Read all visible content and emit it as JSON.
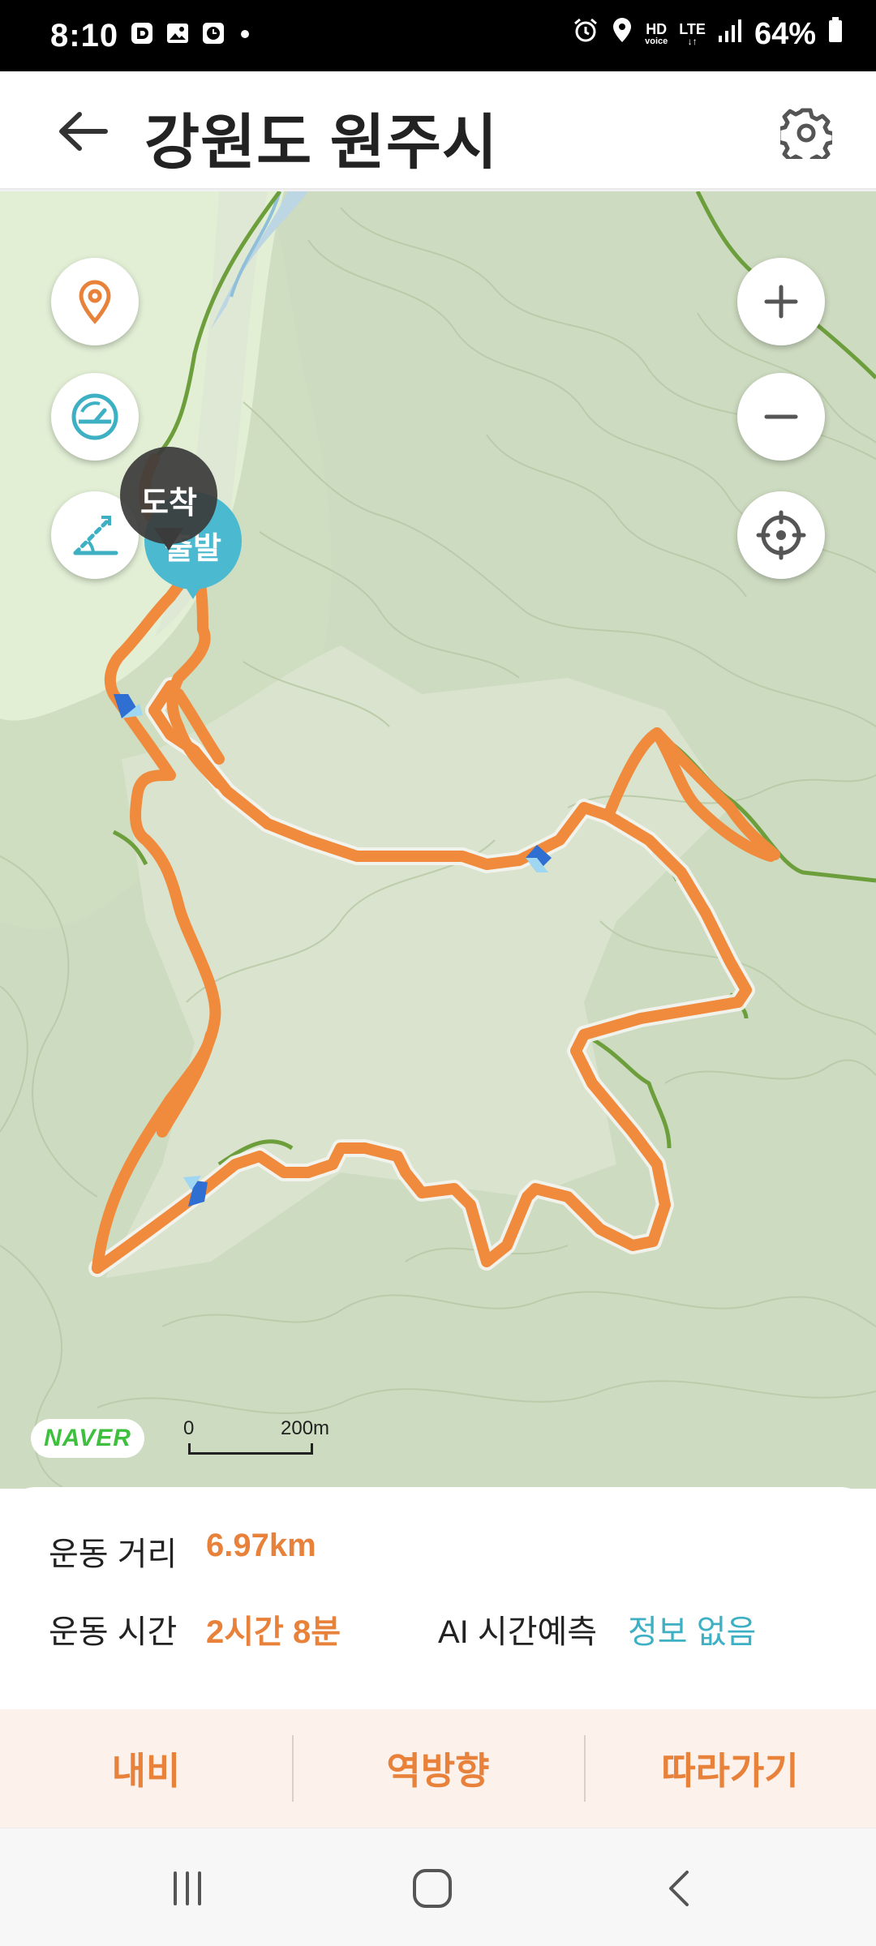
{
  "status_bar": {
    "time": "8:10",
    "hd_label": "HD",
    "voice_label": "voice",
    "lte_label": "LTE",
    "battery": "64%"
  },
  "header": {
    "title": "강원도 원주시"
  },
  "map": {
    "arrival_label": "도착",
    "start_label": "출발",
    "provider": "NAVER",
    "scale_zero": "0",
    "scale_distance": "200m",
    "route_color": "#f08a3c",
    "route_outline_color": "#6a9a3c"
  },
  "stats": {
    "distance_label": "운동 거리",
    "distance_value": "6.97km",
    "time_label": "운동 시간",
    "time_value": "2시간 8분",
    "ai_label": "AI 시간예측",
    "ai_value": "정보 없음"
  },
  "actions": {
    "navigate": "내비",
    "reverse": "역방향",
    "follow": "따라가기"
  },
  "colors": {
    "accent": "#e8813a",
    "teal": "#3eb0c3"
  }
}
